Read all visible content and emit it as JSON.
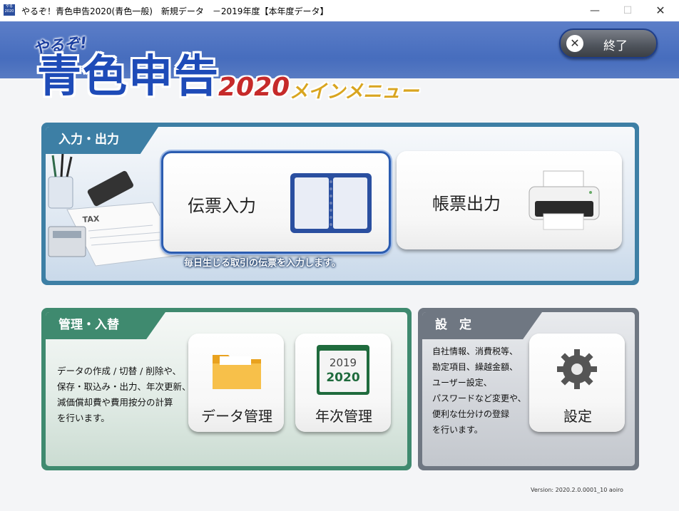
{
  "window": {
    "title": "やるぞ！青色申告2020(青色一般)　新規データ　－2019年度【本年度データ】",
    "icon_text": "やるぞ\n2020",
    "minimize_icon": "minimize-icon",
    "maximize_icon": "maximize-icon",
    "close_icon": "close-icon"
  },
  "header": {
    "logo_tagline": "やるぞ!",
    "logo_main": "青色申告",
    "logo_year": "2020",
    "logo_subtitle": "メインメニュー",
    "exit_label": "終了",
    "exit_icon": "close-circle-icon"
  },
  "sections": {
    "io": {
      "tab_label": "入力・出力",
      "buttons": {
        "voucher": {
          "label": "伝票入力",
          "icon": "notebook-icon"
        },
        "report": {
          "label": "帳票出力",
          "icon": "printer-icon"
        }
      },
      "hint": "毎日生じる取引の伝票を入力します。"
    },
    "management": {
      "tab_label": "管理・入替",
      "description": "データの作成 / 切替 / 削除や、\n保存・取込み・出力、年次更新、\n減価償却費や費用按分の計算\nを行います。",
      "buttons": {
        "data": {
          "label": "データ管理",
          "icon": "folder-icon"
        },
        "annual": {
          "label": "年次管理",
          "icon": "calendar-icon",
          "year_from": "2019",
          "year_to": "2020"
        }
      }
    },
    "settings": {
      "tab_label": "設　定",
      "description": "自社情報、消費税等、\n勘定項目、繰越金額、\nユーザー設定、\nパスワードなど変更や、\n便利な仕分けの登録\nを行います。",
      "button": {
        "label": "設定",
        "icon": "gear-icon"
      }
    }
  },
  "footer": {
    "version": "Version: 2020.2.0.0001_10 aoiro"
  }
}
